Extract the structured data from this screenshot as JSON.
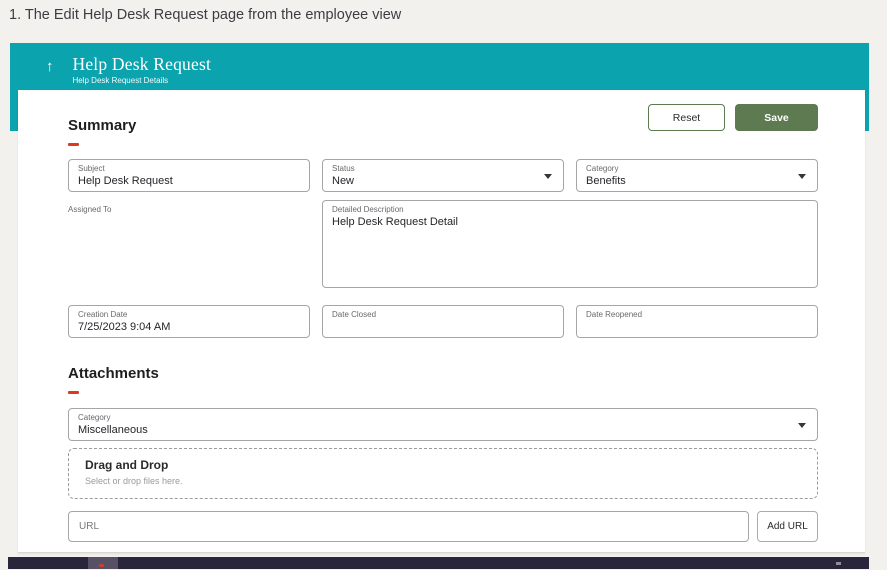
{
  "caption": "1. The Edit Help Desk Request page from the employee view",
  "colors": {
    "banner_teal": "#0aa3ae",
    "save_green": "#5d7a50",
    "accent_red": "#d63b25",
    "page_background": "#f2f1ee",
    "taskbar_dark": "#29253a"
  },
  "banner": {
    "back_icon": "↑",
    "title": "Help Desk Request",
    "subtitle": "Help Desk Request Details"
  },
  "toolbar": {
    "reset_label": "Reset",
    "save_label": "Save"
  },
  "summary": {
    "heading": "Summary",
    "fields": {
      "subject": {
        "label": "Subject",
        "value": "Help Desk Request"
      },
      "status": {
        "label": "Status",
        "value": "New"
      },
      "category": {
        "label": "Category",
        "value": "Benefits"
      },
      "assigned_to": {
        "label": "Assigned To",
        "value": ""
      },
      "detailed_description": {
        "label": "Detailed Description",
        "value": "Help Desk Request Detail"
      },
      "creation_date": {
        "label": "Creation Date",
        "value": "7/25/2023 9:04 AM"
      },
      "date_closed": {
        "label": "Date Closed",
        "value": ""
      },
      "date_reopened": {
        "label": "Date Reopened",
        "value": ""
      }
    }
  },
  "attachments": {
    "heading": "Attachments",
    "category": {
      "label": "Category",
      "value": "Miscellaneous"
    },
    "dropzone": {
      "title": "Drag and Drop",
      "subtitle": "Select or drop files here."
    },
    "url": {
      "placeholder": "URL",
      "add_button_label": "Add URL"
    }
  }
}
